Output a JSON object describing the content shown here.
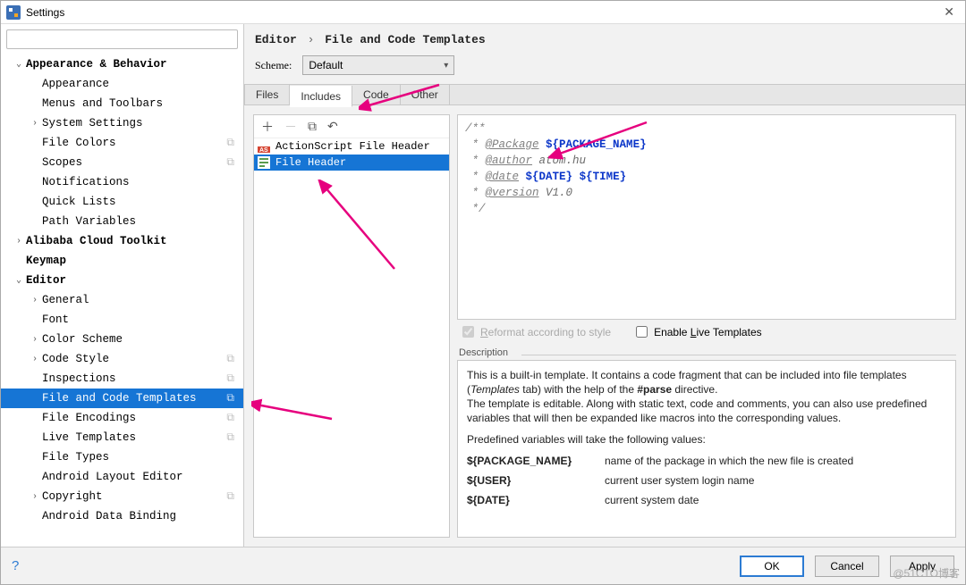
{
  "window": {
    "title": "Settings"
  },
  "search": {
    "placeholder": ""
  },
  "tree": [
    {
      "label": "Appearance & Behavior",
      "indent": 0,
      "arrow": "v",
      "bold": true
    },
    {
      "label": "Appearance",
      "indent": 1
    },
    {
      "label": "Menus and Toolbars",
      "indent": 1
    },
    {
      "label": "System Settings",
      "indent": 1,
      "arrow": ">"
    },
    {
      "label": "File Colors",
      "indent": 1,
      "dup": true
    },
    {
      "label": "Scopes",
      "indent": 1,
      "dup": true
    },
    {
      "label": "Notifications",
      "indent": 1
    },
    {
      "label": "Quick Lists",
      "indent": 1
    },
    {
      "label": "Path Variables",
      "indent": 1
    },
    {
      "label": "Alibaba Cloud Toolkit",
      "indent": 0,
      "arrow": ">",
      "bold": true
    },
    {
      "label": "Keymap",
      "indent": 0,
      "bold": true
    },
    {
      "label": "Editor",
      "indent": 0,
      "arrow": "v",
      "bold": true
    },
    {
      "label": "General",
      "indent": 1,
      "arrow": ">"
    },
    {
      "label": "Font",
      "indent": 1
    },
    {
      "label": "Color Scheme",
      "indent": 1,
      "arrow": ">"
    },
    {
      "label": "Code Style",
      "indent": 1,
      "arrow": ">",
      "dup": true
    },
    {
      "label": "Inspections",
      "indent": 1,
      "dup": true
    },
    {
      "label": "File and Code Templates",
      "indent": 1,
      "dup": true,
      "selected": true
    },
    {
      "label": "File Encodings",
      "indent": 1,
      "dup": true
    },
    {
      "label": "Live Templates",
      "indent": 1,
      "dup": true
    },
    {
      "label": "File Types",
      "indent": 1
    },
    {
      "label": "Android Layout Editor",
      "indent": 1
    },
    {
      "label": "Copyright",
      "indent": 1,
      "arrow": ">",
      "dup": true
    },
    {
      "label": "Android Data Binding",
      "indent": 1
    }
  ],
  "breadcrumb": {
    "a": "Editor",
    "b": "File and Code Templates"
  },
  "scheme": {
    "label": "Scheme:",
    "value": "Default"
  },
  "tabs": [
    "Files",
    "Includes",
    "Code",
    "Other"
  ],
  "tabActive": 1,
  "templates": [
    {
      "label": "ActionScript File Header",
      "icon": "as"
    },
    {
      "label": "File Header",
      "icon": "inc",
      "selected": true
    }
  ],
  "editor": {
    "pkg_tag": "@Package",
    "pkg_var": "${PACKAGE_NAME}",
    "auth_tag": "@author",
    "auth_val": "atom.hu",
    "date_tag": "@date",
    "date_var": "${DATE}",
    "time_var": "${TIME}",
    "ver_tag": "@version",
    "ver_val": "V1.0"
  },
  "opts": {
    "reformat": "Reformat according to style",
    "live": "Enable Live Templates"
  },
  "descTitle": "Description",
  "desc": {
    "p1a": "This is a built-in template. It contains a code fragment that can be included into file templates (",
    "p1b": "Templates",
    "p1c": " tab) with the help of the ",
    "p1d": "#parse",
    "p1e": " directive.",
    "p2": "The template is editable. Along with static text, code and comments, you can also use predefined variables that will then be expanded like macros into the corresponding values.",
    "p3": "Predefined variables will take the following values:",
    "vars": [
      {
        "n": "${PACKAGE_NAME}",
        "d": "name of the package in which the new file is created"
      },
      {
        "n": "${USER}",
        "d": "current user system login name"
      },
      {
        "n": "${DATE}",
        "d": "current system date"
      }
    ]
  },
  "buttons": {
    "ok": "OK",
    "cancel": "Cancel",
    "apply": "Apply"
  },
  "watermark": "@51CTO博客"
}
